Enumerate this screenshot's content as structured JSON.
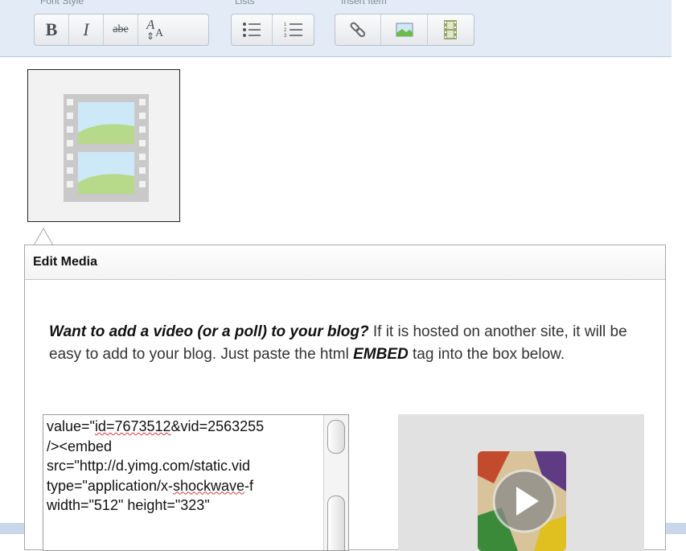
{
  "toolbar": {
    "groups": [
      {
        "label": "Font Style",
        "buttons": [
          "B",
          "I",
          "abe",
          "A"
        ]
      },
      {
        "label": "Lists",
        "buttons": [
          "bulleted-list",
          "numbered-list"
        ]
      },
      {
        "label": "Insert Item",
        "buttons": [
          "link",
          "image",
          "media"
        ]
      }
    ],
    "font_style_label": "Font Style",
    "lists_label": "Lists",
    "insert_label": "Insert Item",
    "bold": "B",
    "italic": "I",
    "strike": "abe",
    "font_size_A": "A",
    "font_size_a": "A"
  },
  "popup": {
    "title": "Edit Media",
    "intro_bold": "Want to add a video (or a poll) to your blog?",
    "intro_text": " If it is hosted on another site, it will be easy to add to your blog. Just paste the html ",
    "intro_bold2": "EMBED",
    "intro_text2": " tag into the box below."
  },
  "embed": {
    "lines": [
      "value=\"id=7673512&vid=2563255",
      "/><embed",
      "src=\"http://d.yimg.com/static.vid",
      "type=\"application/x-shockwave-f",
      "width=\"512\" height=\"323\""
    ]
  },
  "colors": {
    "toolbar_bg": "#e3ecf6",
    "popup_border": "#a7a7a7",
    "preview_bg": "#e1e1e1"
  }
}
